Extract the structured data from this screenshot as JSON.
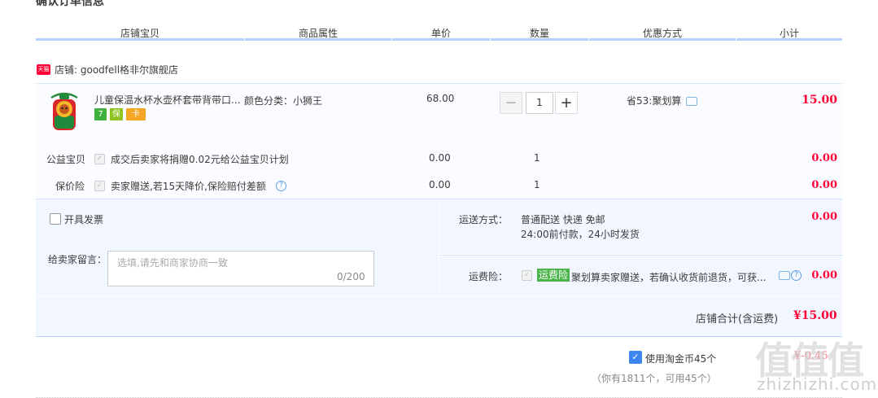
{
  "section_title": "确认订单信息",
  "columns": [
    "店铺宝贝",
    "商品属性",
    "单价",
    "数量",
    "优惠方式",
    "小计"
  ],
  "shop": {
    "icon_text": "天猫",
    "label": "店铺: goodfell格非尔旗舰店"
  },
  "item": {
    "title": "儿童保温水杯水壶杯套带背带口...",
    "attribute": "颜色分类：小狮王",
    "price": "68.00",
    "quantity": "1",
    "promo": "省53:聚划算",
    "subtotal": "15.00",
    "badges": [
      "7",
      "保",
      "卡"
    ]
  },
  "charity": {
    "label": "公益宝贝",
    "text": "成交后卖家将捐赠0.02元给公益宝贝计划",
    "price": "0.00",
    "qty": "1",
    "subtotal": "0.00"
  },
  "price_protect": {
    "label": "保价险",
    "text": "卖家赠送,若15天降价,保险赔付差额",
    "price": "0.00",
    "qty": "1",
    "subtotal": "0.00"
  },
  "invoice": {
    "label": "开具发票"
  },
  "memo": {
    "label": "给卖家留言：",
    "placeholder": "选填,请先和商家协商一致",
    "count": "0/200"
  },
  "shipping": {
    "label": "运送方式：",
    "line1": "普通配送 快递 免邮",
    "line2": "24:00前付款，24小时发货",
    "fee": "0.00"
  },
  "ship_insurance": {
    "label": "运费险：",
    "tag": "运费险",
    "text": "聚划算卖家赠送，若确认收货前退货，可获...",
    "fee": "0.00"
  },
  "total": {
    "label": "店铺合计(含运费)",
    "value": "¥15.00"
  },
  "coins": {
    "label": "使用淘金币45个",
    "value": "¥-0.45",
    "note": "（你有1811个，可用45个）"
  },
  "watermark": {
    "text": "值值值",
    "url": "zhizhizhi.com"
  },
  "colors": {
    "accent_red": "#ff0036",
    "header_line": "#b2d1ff",
    "block_bg": "#f2f7ff",
    "checkbox_blue": "#3b86f0",
    "insurance_green": "#4ab44a"
  }
}
